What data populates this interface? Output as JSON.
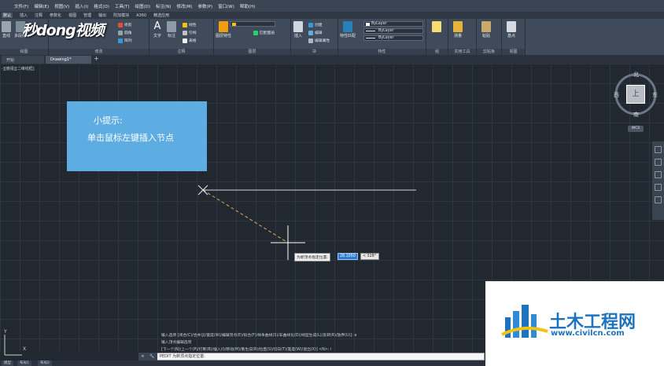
{
  "menu": [
    "文件(F)",
    "编辑(E)",
    "视图(V)",
    "插入(I)",
    "格式(O)",
    "工具(T)",
    "绘图(D)",
    "标注(N)",
    "修改(M)",
    "参数(P)",
    "窗口(W)",
    "帮助(H)"
  ],
  "ribbon_tabs": [
    "默认",
    "插入",
    "注释",
    "参数化",
    "视图",
    "管理",
    "输出",
    "附加模块",
    "A360",
    "精选应用"
  ],
  "ribbon": {
    "draw": {
      "line": "直线",
      "polyline": "多段线",
      "label": "绘图"
    },
    "modify": {
      "hatch": "修剪",
      "fillet": "圆角",
      "array": "阵列",
      "label": "修改"
    },
    "annotation": {
      "text": "文字",
      "dim": "标注",
      "linear": "线性",
      "leader": "引线",
      "table": "表格",
      "label": "注释"
    },
    "layers": {
      "props": "图层特性",
      "match": "匹配图层",
      "label": "图层"
    },
    "block": {
      "insert": "插入",
      "create": "创建",
      "edit": "编辑",
      "attr": "编辑属性",
      "label": "块"
    },
    "properties": {
      "match": "特性匹配",
      "bylayer1": "ByLayer",
      "bylayer2": "ByLayer",
      "bylayer3": "ByLayer",
      "label": "特性"
    },
    "groups": {
      "label": "组"
    },
    "utilities": {
      "measure": "测量",
      "label": "实用工具"
    },
    "clipboard": {
      "paste": "粘贴",
      "label": "剪贴板"
    },
    "view": {
      "base": "基点",
      "label": "视图"
    }
  },
  "watermark": "秒dong视频",
  "doc_tabs": [
    "开始",
    "Drawing1*"
  ],
  "view_label": "-][俯视][二维线框]",
  "tip": {
    "title": "小提示:",
    "body": "单击鼠标左键插入节点"
  },
  "dynamic_input": {
    "prompt": "为新顶点指定位置:",
    "value": "28.1050",
    "angle": "< 328°"
  },
  "viewcube": {
    "north": "北",
    "south": "南",
    "west": "西",
    "east": "东",
    "face": "上",
    "wcs": "WCS"
  },
  "history": [
    "输入选项 [闭合(C)/合并(J)/宽度(W)/编辑顶点(E)/拟合(F)/样条曲线(S)/非曲线化(D)/线型生成(L)/反转(R)/放弃(U)]: e",
    "输入顶点编辑选项",
    "[下一个(N)/上一个(P)/打断(B)/插入(I)/移动(M)/重生成(R)/拉直(S)/切向(T)/宽度(W)/退出(X)] <N>: i"
  ],
  "command_line": "PEDIT 为新顶点指定位置:",
  "layout_tabs": [
    "模型",
    "布局1",
    "布局2"
  ],
  "brand": {
    "name": "土木工程网",
    "url": "www.civilcn.com"
  },
  "ucs": {
    "x": "X",
    "y": "Y"
  }
}
